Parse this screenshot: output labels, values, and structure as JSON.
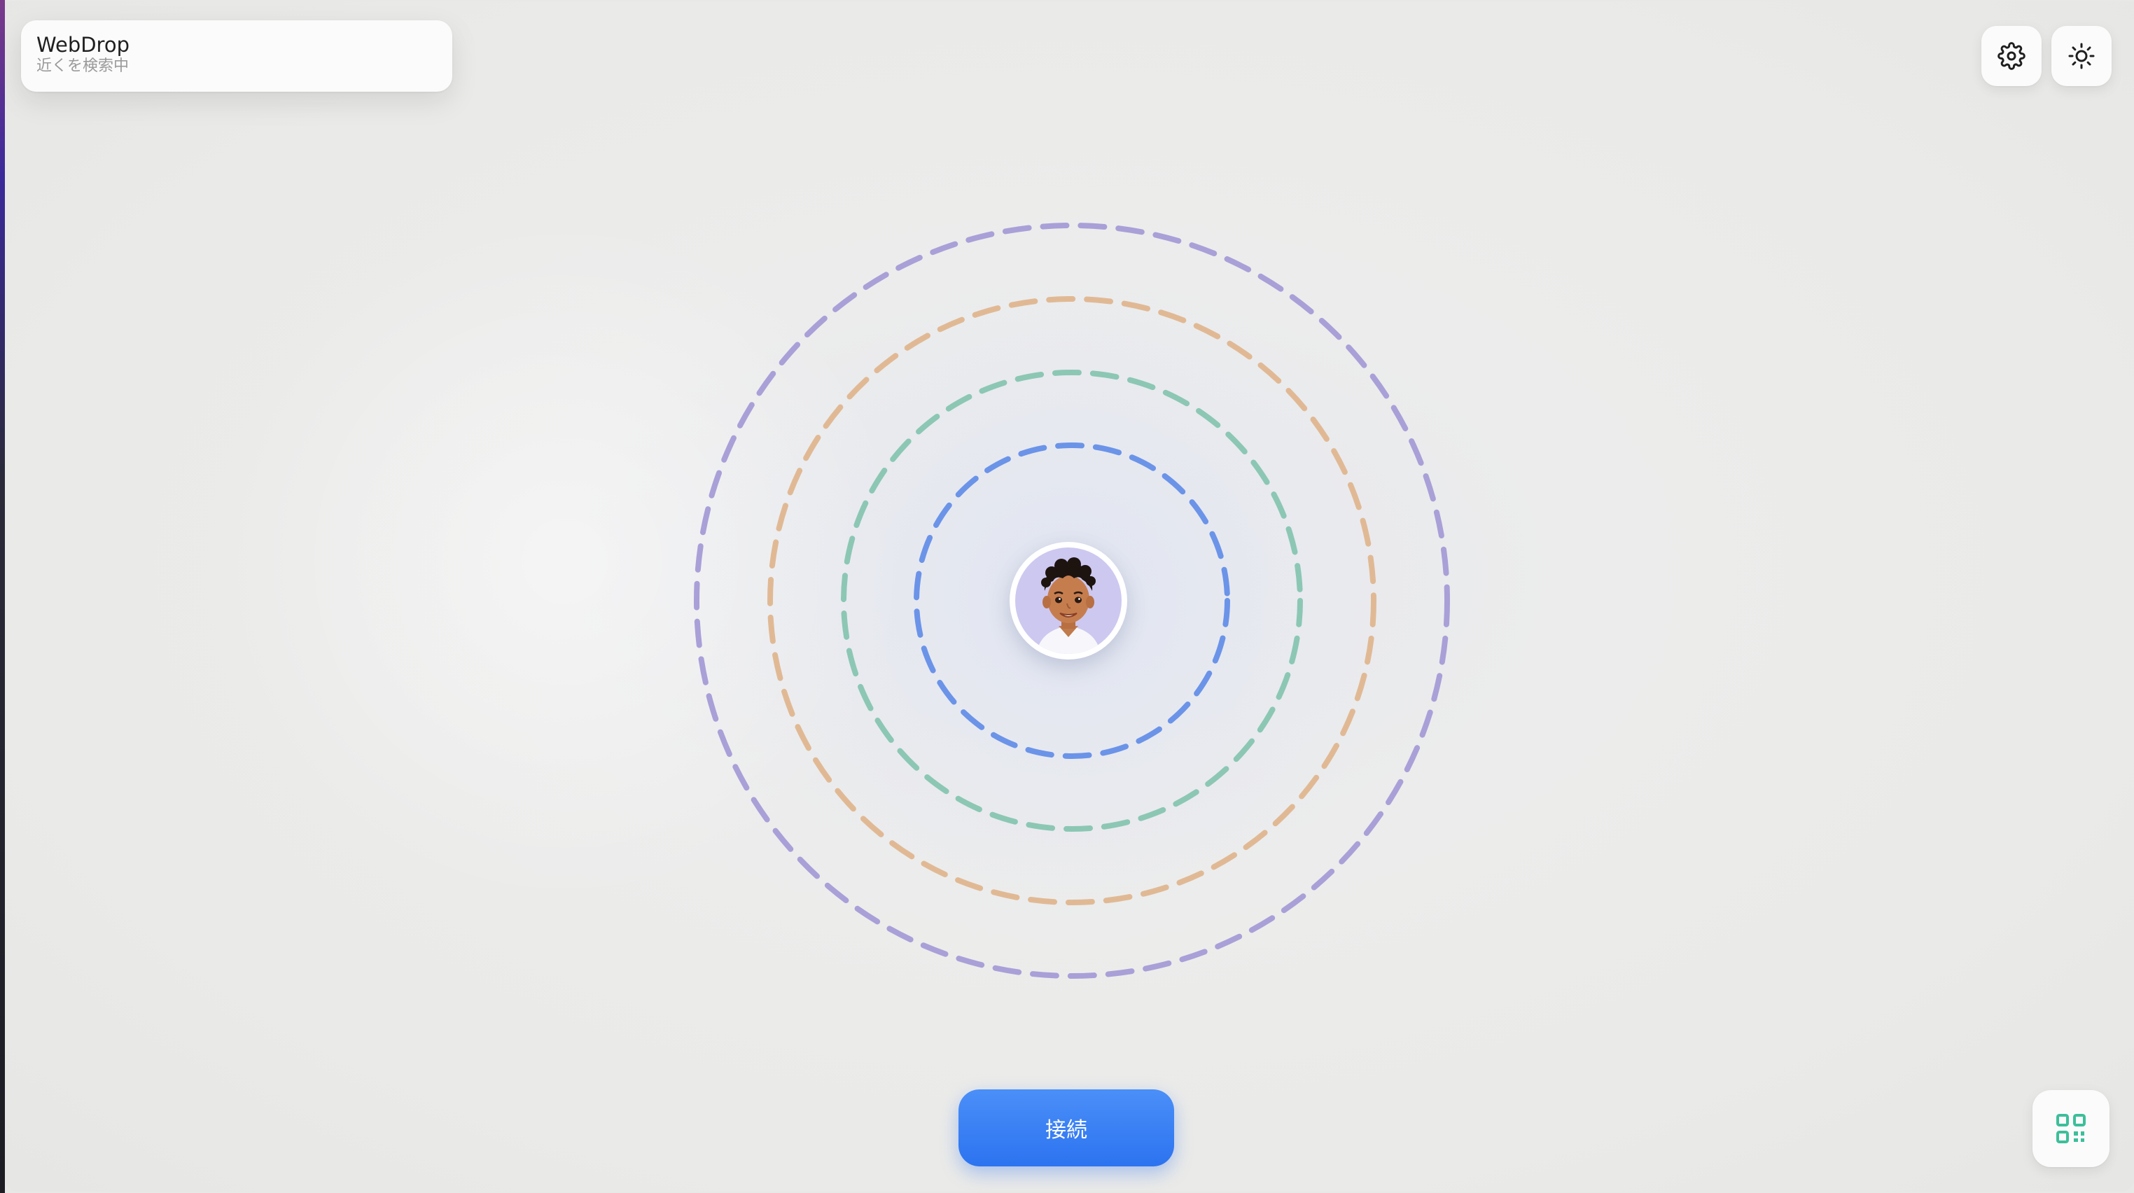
{
  "app": {
    "title": "WebDrop",
    "status": "近くを検索中"
  },
  "toolbar": {
    "settings_icon": "gear-icon",
    "theme_icon": "sun-icon"
  },
  "radar": {
    "rings": [
      {
        "name": "ring-1",
        "color": "#6b94e8"
      },
      {
        "name": "ring-2",
        "color": "#8cc7b4"
      },
      {
        "name": "ring-3",
        "color": "#e0b994"
      },
      {
        "name": "ring-4",
        "color": "#a9a0d8"
      }
    ]
  },
  "user": {
    "avatar_icon": "user-avatar"
  },
  "actions": {
    "connect_label": "接続",
    "qr_icon": "qr-code-icon"
  },
  "colors": {
    "accent": "#2f76f2",
    "qr_accent": "#3cbf9a"
  }
}
